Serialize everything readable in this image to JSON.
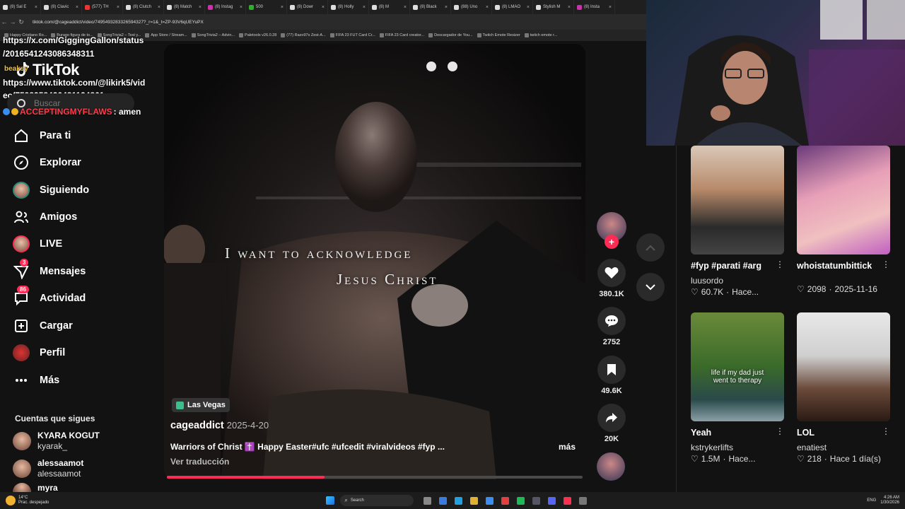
{
  "browser": {
    "tabs": [
      {
        "label": "(8) Sal E",
        "color": "#ddd"
      },
      {
        "label": "(8) Clavic",
        "color": "#ddd"
      },
      {
        "label": "(577) TH",
        "color": "#e33"
      },
      {
        "label": "(8) Clutch",
        "color": "#ddd"
      },
      {
        "label": "(8) Match",
        "color": "#ddd"
      },
      {
        "label": "(8) Instag",
        "color": "#c3a"
      },
      {
        "label": "500",
        "color": "#3a3"
      },
      {
        "label": "(8) Dowr",
        "color": "#ddd"
      },
      {
        "label": "(8) Holly",
        "color": "#ddd"
      },
      {
        "label": "(8) M",
        "color": "#ddd"
      },
      {
        "label": "(8) Black",
        "color": "#ddd"
      },
      {
        "label": "(88) Uno",
        "color": "#ddd"
      },
      {
        "label": "(8) LMAO",
        "color": "#ddd"
      },
      {
        "label": "Stylish M",
        "color": "#ddd"
      },
      {
        "label": "(8) Insta",
        "color": "#c3a"
      }
    ],
    "url": "tiktok.com/@cageaddict/video/7495493283326594327?_r=1&_t=ZP-93V6qUEYuPX",
    "bookmarks": [
      "Happy Cristiano Ro...",
      "Burago figura de to...",
      "SongTrivia2 – Test y...",
      "App Store / Stream...",
      "SongTrivia2 – Advin...",
      "Paletools v26.0.28",
      "(77) Razo97s Zest-A...",
      "FIFA 23 FUT Card Cr...",
      "FIFA 23 Card creator...",
      "Descargador de You...",
      "Twitch Emote Resizer",
      "twitch emote r..."
    ]
  },
  "stream_overlay": {
    "line1": "https://x.com/GiggingGallon/status",
    "line2": "/2016541243086348311",
    "line3": "https://www.tiktok.com/@likirk5/vid",
    "line4": "eo/7598358426481134861",
    "chat_user": "ACCEPTINGMYFLAWS",
    "chat_msg": ": amen",
    "chat_prefix": "beaksy"
  },
  "sidebar": {
    "logo": "TikTok",
    "search_placeholder": "Buscar",
    "items": [
      {
        "label": "Para ti",
        "icon": "home-icon"
      },
      {
        "label": "Explorar",
        "icon": "compass-icon"
      },
      {
        "label": "Siguiendo",
        "icon": "following-avatar-icon"
      },
      {
        "label": "Amigos",
        "icon": "friends-icon"
      },
      {
        "label": "LIVE",
        "icon": "live-avatar-icon"
      },
      {
        "label": "Mensajes",
        "icon": "messages-icon",
        "badge": "3"
      },
      {
        "label": "Actividad",
        "icon": "activity-icon",
        "badge": "86"
      },
      {
        "label": "Cargar",
        "icon": "upload-icon"
      },
      {
        "label": "Perfil",
        "icon": "profile-avatar-icon"
      },
      {
        "label": "Más",
        "icon": "more-icon"
      }
    ],
    "following_title": "Cuentas que sigues",
    "following": [
      {
        "name": "KYARA KOGUT",
        "handle": "kyarak_"
      },
      {
        "name": "alessaamot",
        "handle": "alessaamot"
      },
      {
        "name": "myra",
        "handle": ""
      }
    ]
  },
  "video": {
    "caption_line1": "I want to acknowledge",
    "caption_line2": "Jesus Christ",
    "location": "Las Vegas",
    "author": "cageaddict",
    "date": "2025-4-20",
    "description": "Warriors of Christ ✝️ Happy Easter#ufc #ufcedit #viralvideos #fyp ...",
    "more": "más",
    "translate": "Ver traducción",
    "progress": 0.38,
    "likes": "380.1K",
    "comments": "2752",
    "saves": "49.6K",
    "shares": "20K"
  },
  "recommended": [
    {
      "title": "#fyp #parati #arg",
      "user": "luusordo",
      "stats": "60.7K",
      "when": "Hace...",
      "thumb_text": ""
    },
    {
      "title": "whoistatumbittick",
      "user": "",
      "stats": "2098",
      "when": "2025-11-16",
      "thumb_text": ""
    },
    {
      "title": "Yeah",
      "user": "kstrykerlifts",
      "stats": "1.5M",
      "when": "Hace...",
      "thumb_text": "life if my dad just went to therapy"
    },
    {
      "title": "LOL",
      "user": "enatiest",
      "stats": "218",
      "when": "Hace 1 día(s)",
      "thumb_text": ""
    }
  ],
  "taskbar": {
    "weather_temp": "14°C",
    "weather_desc": "Prac. despejado",
    "search": "Search",
    "lang": "ENG",
    "time": "4:26 AM",
    "date": "1/30/2026"
  },
  "colors": {
    "accent": "#fe2c55",
    "bg": "#121212",
    "panel": "#2a2a2a"
  }
}
